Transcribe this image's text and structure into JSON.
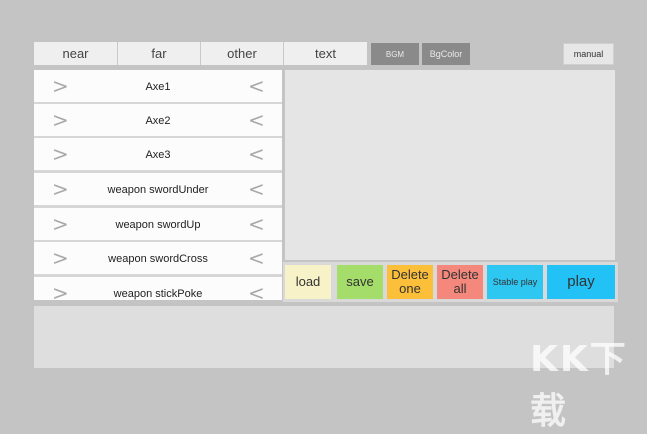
{
  "tabs": {
    "near": "near",
    "far": "far",
    "other": "other",
    "text": "text"
  },
  "toolbar": {
    "bgm": "BGM",
    "bgcolor": "BgColor",
    "manual": "manual"
  },
  "list": {
    "items": [
      {
        "label": "Axe1"
      },
      {
        "label": "Axe2"
      },
      {
        "label": "Axe3"
      },
      {
        "label": "weapon swordUnder"
      },
      {
        "label": "weapon swordUp"
      },
      {
        "label": "weapon swordCross"
      },
      {
        "label": "weapon stickPoke"
      }
    ],
    "arrow_left": ">",
    "arrow_right": "<"
  },
  "actions": {
    "load": "load",
    "save": "save",
    "delete_one": "Delete one",
    "delete_all": "Delete all",
    "stable_play": "Stable play",
    "play": "play"
  },
  "colors": {
    "load": "#f7f2c8",
    "save": "#a4dd6a",
    "delete_one": "#fbbf3a",
    "delete_all": "#f4887c",
    "stable_play": "#2ec7f2",
    "play": "#22c2f6"
  },
  "watermark": "KK下载"
}
